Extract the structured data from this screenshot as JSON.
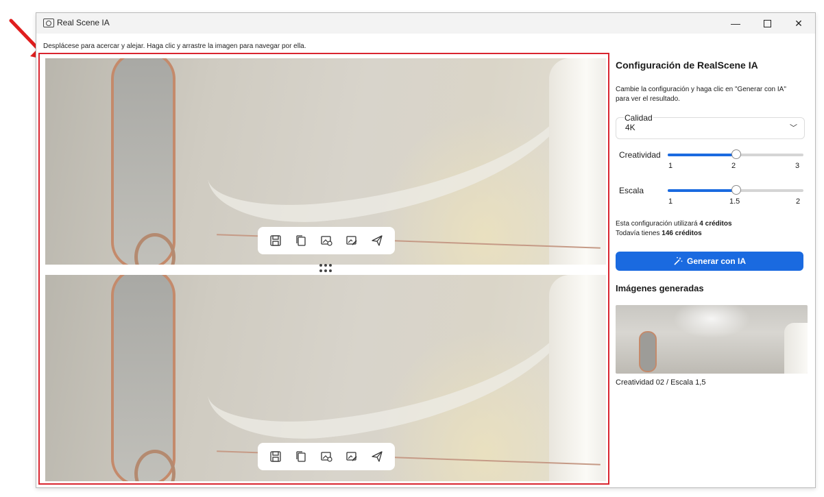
{
  "window": {
    "title": "Real Scene IA"
  },
  "hint": "Desplácese para acercar y alejar. Haga clic y arrastre la imagen para navegar por ella.",
  "toolbar_icons": [
    "save-icon",
    "copy-icon",
    "image-settings-icon",
    "image-edit-icon",
    "send-icon"
  ],
  "panel": {
    "title": "Configuración de RealScene IA",
    "description": "Cambie la configuración y haga clic en \"Generar con IA\" para ver el resultado.",
    "quality": {
      "label": "Calidad",
      "value": "4K"
    },
    "creatividad": {
      "label": "Creatividad",
      "min": "1",
      "mid": "2",
      "max": "3",
      "value": 2
    },
    "escala": {
      "label": "Escala",
      "min": "1",
      "mid": "1.5",
      "max": "2",
      "value": 1.5
    },
    "credits_line1_prefix": "Esta configuración utilizará",
    "credits_line1_bold": "4 créditos",
    "credits_line2_prefix": "Todavía tienes",
    "credits_line2_bold": "146 créditos",
    "generate_label": "Generar con IA",
    "generated_title": "Imágenes generadas",
    "generated_caption": "Creatividad 02 / Escala 1,5"
  },
  "colors": {
    "accent": "#1a6ae0",
    "highlight_border": "#d9252f",
    "arrow": "#e01e1e"
  }
}
